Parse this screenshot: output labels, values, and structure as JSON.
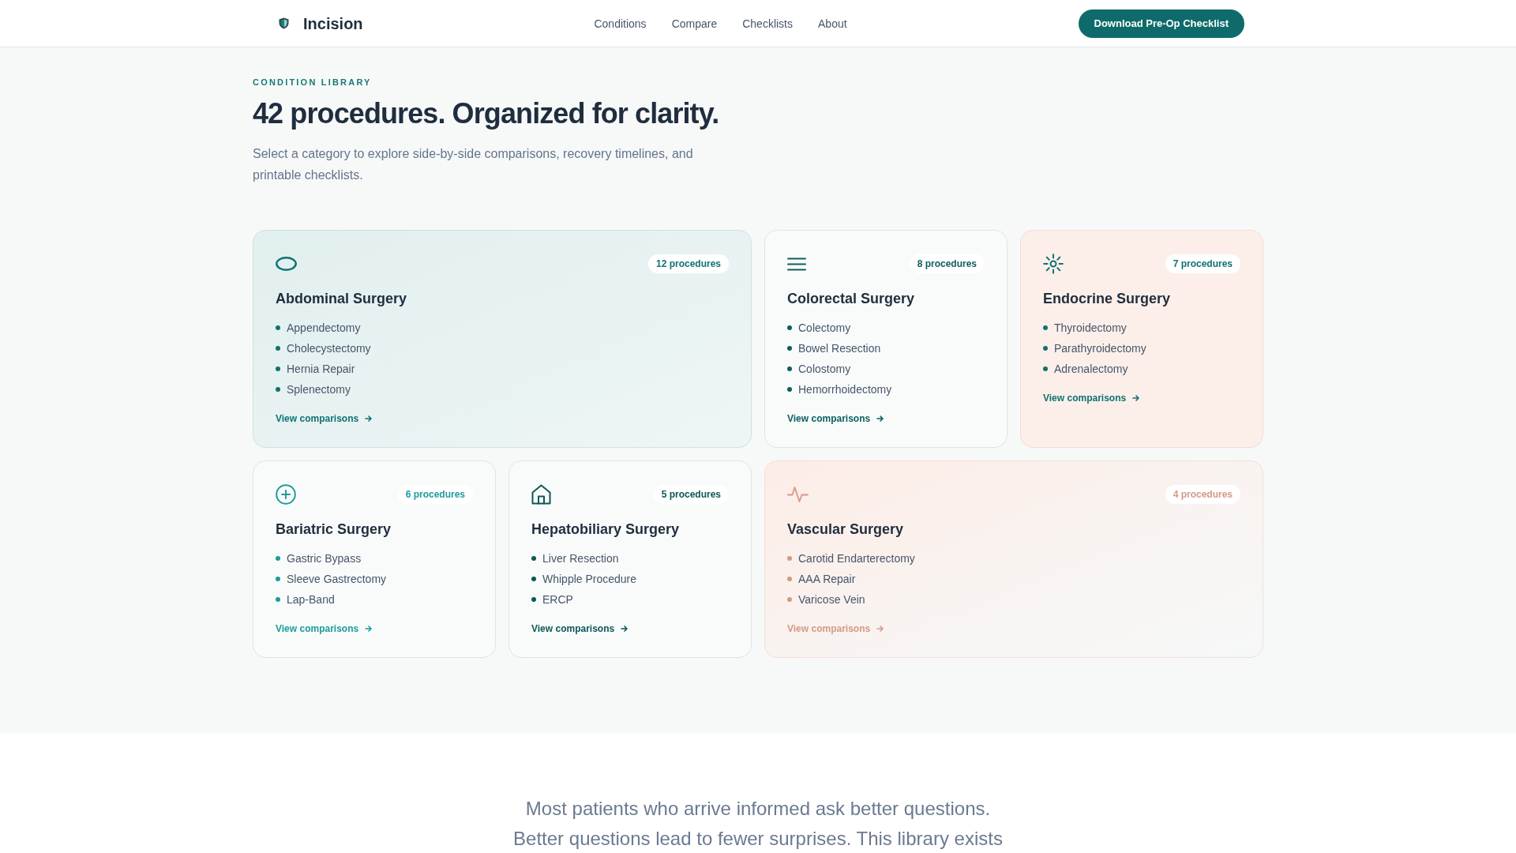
{
  "header": {
    "brand": "Incision",
    "nav": [
      "Conditions",
      "Compare",
      "Checklists",
      "About"
    ],
    "cta": "Download Pre-Op Checklist"
  },
  "intro": {
    "eyebrow": "CONDITION LIBRARY",
    "title": "42 procedures. Organized for clarity.",
    "subtitle": "Select a category to explore side-by-side comparisons, recovery timelines, and printable checklists."
  },
  "categories": [
    {
      "title": "Abdominal Surgery",
      "count": "12 procedures",
      "kind": "tinted",
      "color": "#0f7272",
      "procedures": [
        "Appendectomy",
        "Cholecystectomy",
        "Hernia Repair",
        "Splenectomy"
      ],
      "link": "View comparisons"
    },
    {
      "title": "Colorectal Surgery",
      "count": "8 procedures",
      "kind": "plain",
      "color": "#0e5e5e",
      "procedures": [
        "Colectomy",
        "Bowel Resection",
        "Colostomy",
        "Hemorrhoidectomy"
      ],
      "link": "View comparisons"
    },
    {
      "title": "Endocrine Surgery",
      "count": "7 procedures",
      "kind": "warm",
      "color": "#0f7272",
      "procedures": [
        "Thyroidectomy",
        "Parathyroidectomy",
        "Adrenalectomy"
      ],
      "link": "View comparisons"
    },
    {
      "title": "Bariatric Surgery",
      "count": "6 procedures",
      "kind": "plain",
      "color": "#1c9c9c",
      "procedures": [
        "Gastric Bypass",
        "Sleeve Gastrectomy",
        "Lap-Band"
      ],
      "link": "View comparisons"
    },
    {
      "title": "Hepatobiliary Surgery",
      "count": "5 procedures",
      "kind": "plain",
      "color": "#0d5757",
      "procedures": [
        "Liver Resection",
        "Whipple Procedure",
        "ERCP"
      ],
      "link": "View comparisons"
    },
    {
      "title": "Vascular Surgery",
      "count": "4 procedures",
      "kind": "glow",
      "color": "#d39a86",
      "procedures": [
        "Carotid Endarterectomy",
        "AAA Repair",
        "Varicose Vein"
      ],
      "link": "View comparisons"
    }
  ],
  "mission": {
    "text": "Most patients who arrive informed ask better questions. Better questions lead to fewer surprises. This library exists"
  }
}
